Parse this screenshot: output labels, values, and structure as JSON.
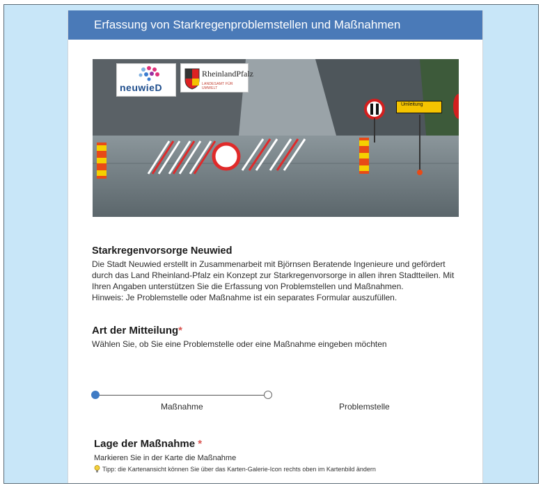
{
  "header": {
    "title": "Erfassung von Starkregenproblemstellen und Maßnahmen"
  },
  "hero": {
    "logo_neuwied": "neuwieD",
    "logo_rlp_name": "RheinlandPfalz",
    "logo_rlp_sub": "LANDESAMT FÜR UMWELT",
    "sign_text": "Umleitung"
  },
  "intro": {
    "title": "Starkregenvorsorge Neuwied",
    "text": "Die Stadt Neuwied erstellt in Zusammenarbeit mit Björnsen Beratende Ingenieure und gefördert durch das Land Rheinland-Pfalz ein Konzept zur Starkregenvorsorge in allen ihren Stadtteilen. Mit Ihren Angaben unterstützen Sie die Erfassung von Problemstellen und Maßnahmen.",
    "note": "Hinweis: Je Problemstelle oder Maßnahme ist ein separates Formular auszufüllen."
  },
  "art": {
    "title": "Art der Mitteilung",
    "required": "*",
    "hint": "Wählen Sie, ob Sie eine Problemstelle oder eine Maßnahme eingeben möchten",
    "options": [
      "Maßnahme",
      "Problemstelle"
    ],
    "selected": "Maßnahme"
  },
  "lage": {
    "title": "Lage der Maßnahme ",
    "required": "*",
    "hint": "Markieren Sie in der Karte die Maßnahme",
    "tip": "Tipp: die Kartenansicht können Sie über das Karten-Galerie-Icon rechts oben im Kartenbild ändern"
  },
  "colors": {
    "header": "#4a7ab8",
    "accent": "#3f7bc4",
    "required": "#d9534f",
    "background": "#c8e6f8"
  }
}
